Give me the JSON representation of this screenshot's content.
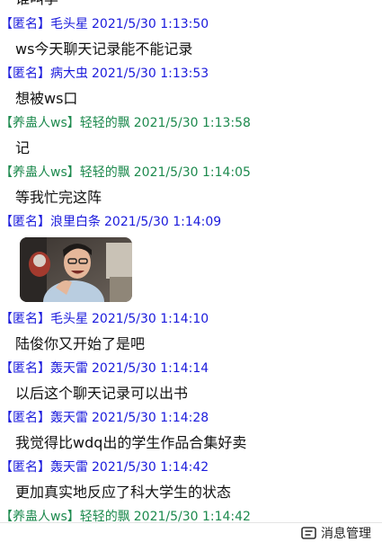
{
  "colors": {
    "anon": "#1a1adc",
    "owner": "#1d8a4e",
    "text": "#111111"
  },
  "icons": {
    "photo_message": "photo-image",
    "message_manager": "message-manager-icon"
  },
  "top_partial_text": "谁叫李",
  "messages": [
    {
      "tag": "【匿名】",
      "sender": "毛头星",
      "time": "2021/5/30 1:13:50",
      "kind": "anon",
      "text": "ws今天聊天记录能不能记录"
    },
    {
      "tag": "【匿名】",
      "sender": "病大虫",
      "time": "2021/5/30 1:13:53",
      "kind": "anon",
      "text": "想被ws口"
    },
    {
      "tag": "【养蛊人ws】",
      "sender": "轻轻的飘",
      "time": "2021/5/30 1:13:58",
      "kind": "owner",
      "text": "记"
    },
    {
      "tag": "【养蛊人ws】",
      "sender": "轻轻的飘",
      "time": "2021/5/30 1:14:05",
      "kind": "owner",
      "text": "等我忙完这阵"
    },
    {
      "tag": "【匿名】",
      "sender": "浪里白条",
      "time": "2021/5/30 1:14:09",
      "kind": "anon",
      "text": ""
    },
    {
      "tag": "【匿名】",
      "sender": "毛头星",
      "time": "2021/5/30 1:14:10",
      "kind": "anon",
      "text": "陆俊你又开始了是吧"
    },
    {
      "tag": "【匿名】",
      "sender": "轰天雷",
      "time": "2021/5/30 1:14:14",
      "kind": "anon",
      "text": "以后这个聊天记录可以出书"
    },
    {
      "tag": "【匿名】",
      "sender": "轰天雷",
      "time": "2021/5/30 1:14:28",
      "kind": "anon",
      "text": "我觉得比wdq出的学生作品合集好卖"
    },
    {
      "tag": "【匿名】",
      "sender": "轰天雷",
      "time": "2021/5/30 1:14:42",
      "kind": "anon",
      "text": "更加真实地反应了科大学生的状态"
    },
    {
      "tag": "【养蛊人ws】",
      "sender": "轻轻的飘",
      "time": "2021/5/30 1:14:42",
      "kind": "owner",
      "text": ""
    }
  ],
  "bottom_bar": {
    "message_manager_label": "消息管理"
  }
}
